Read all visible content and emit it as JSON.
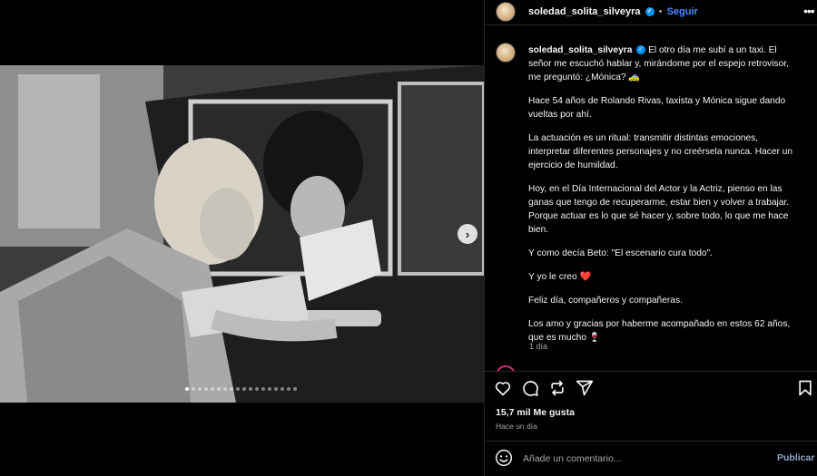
{
  "media": {
    "carousel_count": 18,
    "carousel_active": 0
  },
  "header": {
    "username": "soledad_solita_silveyra",
    "separator": "•",
    "follow_label": "Seguir",
    "more": "•••"
  },
  "caption": {
    "username": "soledad_solita_silveyra",
    "paragraphs": [
      "El otro día me subí a un taxi. El señor me escuchó hablar y, mirándome por el espejo retrovisor, me preguntó: ¿Mónica? 🚕",
      "Hace 54 años de Rolando Rivas, taxista y Mónica sigue dando vueltas por ahí.",
      "La actuación es un ritual: transmitir distintas emociones, interpretar diferentes personajes y no creérsela nunca. Hacer un ejercicio de humildad.",
      "Hoy, en el Día Internacional del Actor y la Actriz, pienso en las ganas que tengo de recuperarme, estar bien y volver a trabajar. Porque actuar es lo que sé hacer y, sobre todo, lo que me hace bien.",
      "Y como decía Beto: \"El escenario cura todo\".",
      "Y yo le creo ❤️",
      "Feliz día, compañeros y compañeras.",
      "Los amo y gracias por haberme acompañado en estos 62 años, que es mucho 🍷"
    ],
    "time": "1 día"
  },
  "stats": {
    "likes": "15,7 mil Me gusta",
    "posted": "Hace un día"
  },
  "comment": {
    "placeholder": "Añade un comentario...",
    "publish_label": "Publicar"
  },
  "icons": {
    "like": "heart-icon",
    "comment": "comment-icon",
    "repost": "repost-icon",
    "share": "share-icon",
    "save": "bookmark-icon",
    "emoji": "emoji-icon",
    "verified": "verified-badge-icon",
    "next": "chevron-right-icon"
  },
  "colors": {
    "background": "#000000",
    "follow": "#4a8dff",
    "verified": "#0095f6",
    "muted": "#a8a8a8",
    "publish": "#8fa6c9"
  }
}
